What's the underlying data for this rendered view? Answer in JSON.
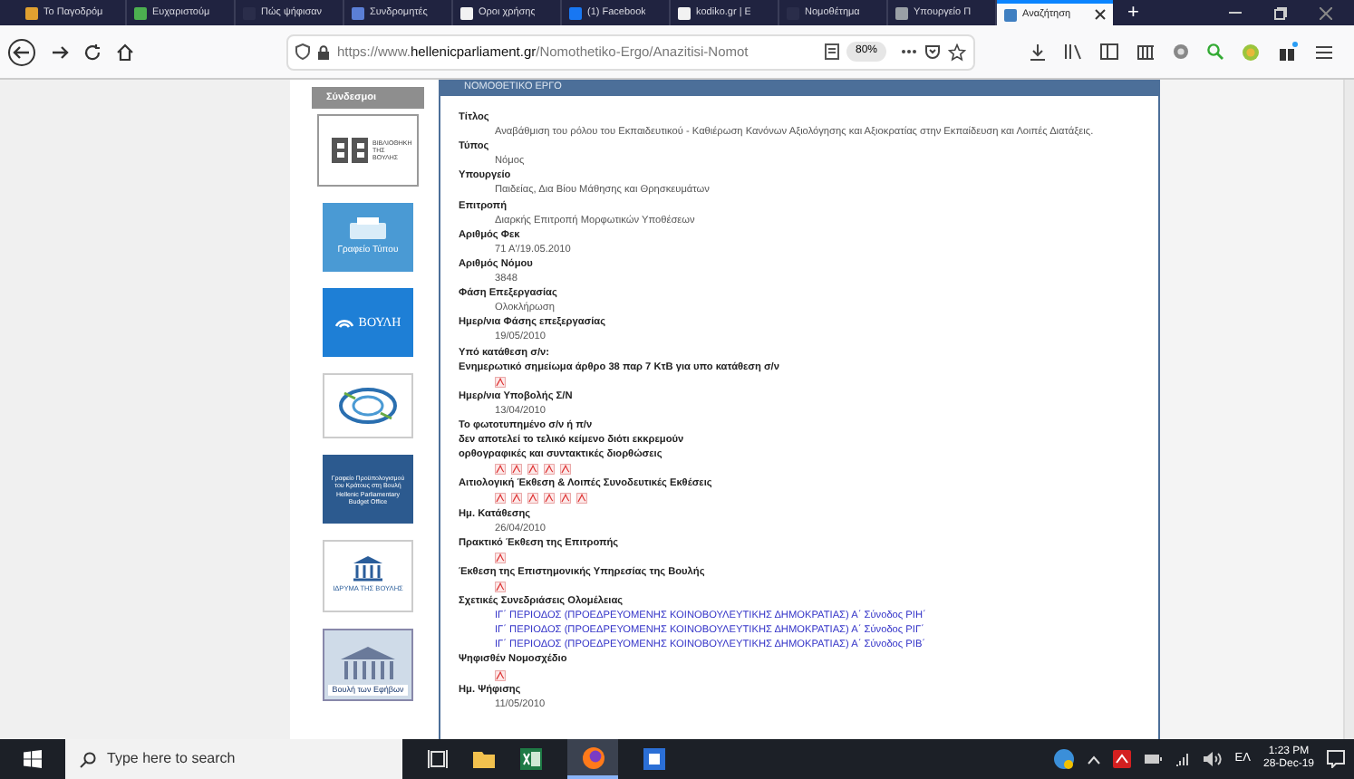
{
  "tabs": [
    {
      "label": "Το Παγοδρόμ",
      "selected": false,
      "color": "#e0a030"
    },
    {
      "label": "Ευχαριστούμ",
      "selected": false,
      "color": "#4caf50"
    },
    {
      "label": "Πώς ψήφισαν",
      "selected": false,
      "color": "#2a2d4a"
    },
    {
      "label": "Συνδρομητές",
      "selected": false,
      "color": "#5b7fd6"
    },
    {
      "label": "Οροι χρήσης",
      "selected": false,
      "color": "#f2f2f2"
    },
    {
      "label": "(1) Facebook",
      "selected": false,
      "color": "#1877f2"
    },
    {
      "label": "kodiko.gr | Ε",
      "selected": false,
      "color": "#f2f2f2"
    },
    {
      "label": "Νομοθέτημα",
      "selected": false,
      "color": "#2a2d4a"
    },
    {
      "label": "Υπουργείο Π",
      "selected": false,
      "color": "#9aa0a6"
    },
    {
      "label": "Αναζήτηση",
      "selected": true,
      "color": "#3f7fc1"
    }
  ],
  "new_tab": "+",
  "url": {
    "prefix": "https://www.",
    "domain": "hellenicparliament.gr",
    "path": "/Nomothetiko-Ergo/Anazitisi-Nomot"
  },
  "zoom": "80%",
  "sidebar": {
    "title": "Σύνδεσμοι",
    "links": [
      {
        "kind": "library",
        "texts": [
          "ΒΙΒΛΙΟΘΗΚΗ ΤΗΣ ΒΟΥΛΗΣ"
        ]
      },
      {
        "kind": "press",
        "texts": [
          "Γραφείο Τύπου"
        ]
      },
      {
        "kind": "tv",
        "texts": [
          "ΒΟΥΛΗ"
        ]
      },
      {
        "kind": "swirl"
      },
      {
        "kind": "budget",
        "texts": [
          "Γραφείο Προϋπολογισμού του Κράτους στη Βουλή",
          "Hellenic Parliamentary Budget Office"
        ]
      },
      {
        "kind": "foundation",
        "texts": [
          "ΙΔΡΥΜΑ ΤΗΣ ΒΟΥΛΗΣ"
        ]
      },
      {
        "kind": "youth",
        "texts": [
          "Βουλή των Εφήβων"
        ]
      }
    ]
  },
  "panel": {
    "title": "ΝΟΜΟΘΕΤΙΚΟ ΕΡΓΟ",
    "entries": [
      {
        "label": [
          "Τίτλος"
        ],
        "value": "Αναβάθμιση του ρόλου του Εκπαιδευτικού - Καθιέρωση Κανόνων Αξιολόγησης και Αξιοκρατίας στην Εκπαίδευση και Λοιπές Διατάξεις."
      },
      {
        "label": [
          "Τύπος"
        ],
        "value": "Νόμος"
      },
      {
        "label": [
          "Υπουργείο"
        ],
        "value": "Παιδείας, Δια Βίου Μάθησης και Θρησκευμάτων"
      },
      {
        "label": [
          "Επιτροπή"
        ],
        "value": "Διαρκής Επιτροπή Μορφωτικών Υποθέσεων"
      },
      {
        "label": [
          "Αριθμός Φεκ"
        ],
        "value": "71 Α'/19.05.2010"
      },
      {
        "label": [
          "Αριθμός Νόμου"
        ],
        "value": "3848"
      },
      {
        "label": [
          "Φάση Επεξεργασίας"
        ],
        "value": "Ολοκλήρωση"
      },
      {
        "label": [
          "Ημερ/νια Φάσης επεξεργασίας"
        ],
        "value": "19/05/2010"
      },
      {
        "label": [
          "Υπό κατάθεση σ/ν:",
          "Ενημερωτικό σημείωμα άρθρο 38 παρ 7 ΚτΒ για υπο κατάθεση σ/ν"
        ],
        "files": [
          {
            "kind": "pdf"
          }
        ]
      },
      {
        "label": [
          "Ημερ/νια Υποβολής Σ/Ν"
        ],
        "value": "13/04/2010"
      },
      {
        "label": [
          "Το φωτοτυπημένο σ/ν ή π/ν",
          "δεν αποτελεί το τελικό κείμενο διότι εκκρεμούν",
          "ορθογραφικές και συντακτικές διορθώσεις"
        ],
        "files": [
          {
            "kind": "pdf"
          },
          {
            "kind": "pdf"
          },
          {
            "kind": "pdf"
          },
          {
            "kind": "pdf"
          },
          {
            "kind": "pdf"
          }
        ]
      },
      {
        "label": [
          "Αιτιολογική Έκθεση & Λοιπές Συνοδευτικές Εκθέσεις"
        ],
        "files": [
          {
            "kind": "pdf"
          },
          {
            "kind": "pdf"
          },
          {
            "kind": "pdf"
          },
          {
            "kind": "pdf"
          },
          {
            "kind": "pdf"
          },
          {
            "kind": "pdf"
          }
        ]
      },
      {
        "label": [
          "Ημ. Κατάθεσης"
        ],
        "value": "26/04/2010"
      },
      {
        "label": [
          "Πρακτικό Έκθεση της Επιτροπής"
        ],
        "files": [
          {
            "kind": "pdf"
          }
        ]
      },
      {
        "label": [
          "Έκθεση της Επιστημονικής Υπηρεσίας της Βουλής"
        ],
        "files": [
          {
            "kind": "pdf"
          }
        ]
      },
      {
        "label": [
          "Σχετικές Συνεδριάσεις Ολομέλειας"
        ],
        "links": [
          "ΙΓ΄ ΠΕΡΙΟΔΟΣ (ΠΡΟΕΔΡΕΥΟΜΕΝΗΣ ΚΟΙΝΟΒΟΥΛΕΥΤΙΚΗΣ ΔΗΜΟΚΡΑΤΙΑΣ) Α΄ Σύνοδος ΡΙΗ΄",
          "ΙΓ΄ ΠΕΡΙΟΔΟΣ (ΠΡΟΕΔΡΕΥΟΜΕΝΗΣ ΚΟΙΝΟΒΟΥΛΕΥΤΙΚΗΣ ΔΗΜΟΚΡΑΤΙΑΣ) Α΄ Σύνοδος ΡΙΓ΄",
          "ΙΓ΄ ΠΕΡΙΟΔΟΣ (ΠΡΟΕΔΡΕΥΟΜΕΝΗΣ ΚΟΙΝΟΒΟΥΛΕΥΤΙΚΗΣ ΔΗΜΟΚΡΑΤΙΑΣ) Α΄ Σύνοδος ΡΙΒ΄"
        ]
      },
      {
        "label": [
          "Ψηφισθέν Νομοσχέδιο"
        ],
        "files": [
          {
            "kind": "pdf"
          }
        ]
      },
      {
        "label": [
          "Ημ. Ψήφισης"
        ],
        "value": "11/05/2010"
      }
    ]
  },
  "taskbar": {
    "search_placeholder": "Type here to search",
    "language": "ΕΛ",
    "time": "1:23 PM",
    "date": "28-Dec-19"
  }
}
